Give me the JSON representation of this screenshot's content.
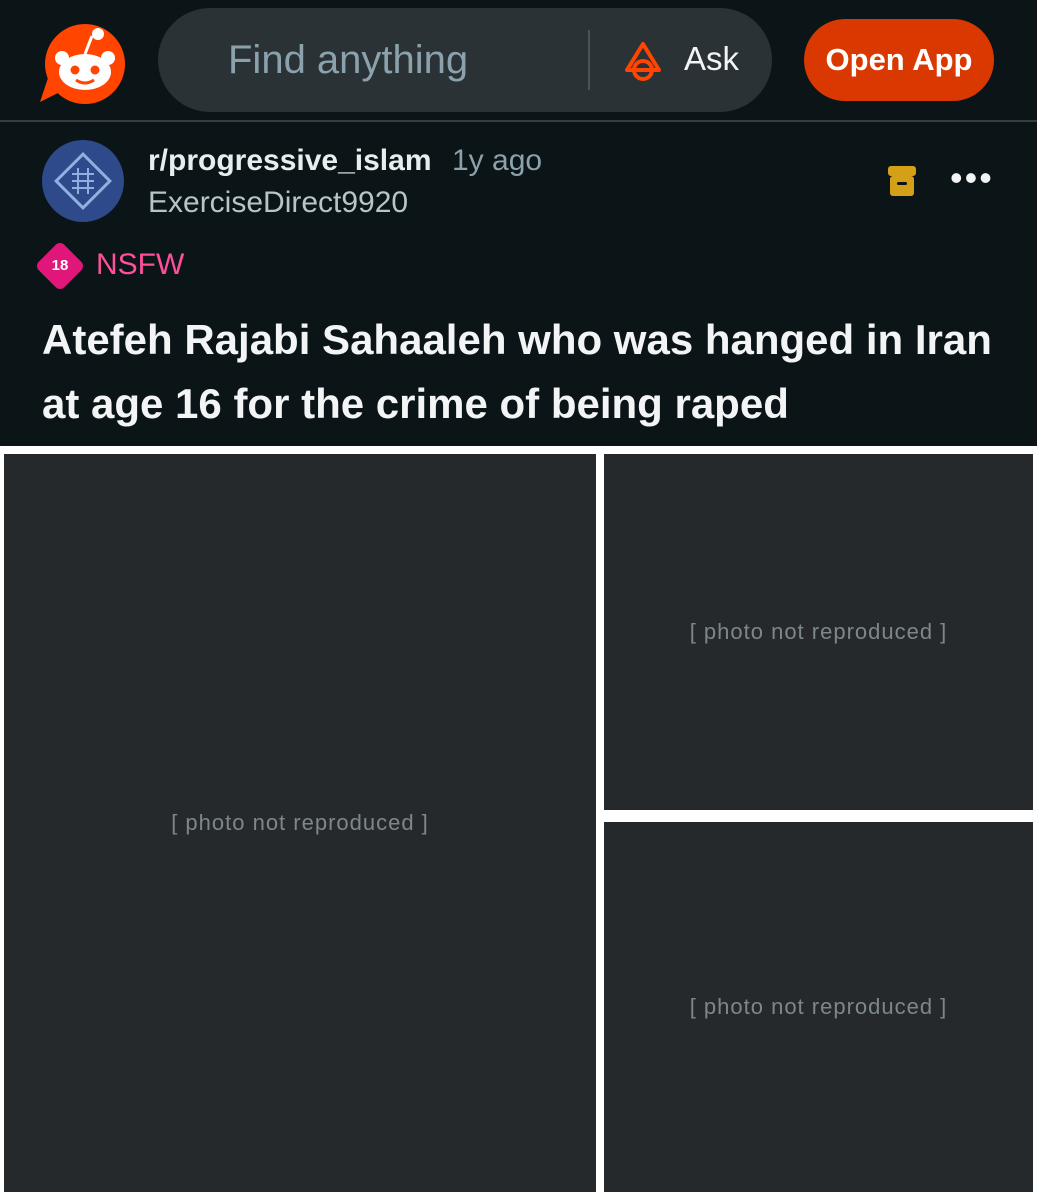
{
  "header": {
    "search_placeholder": "Find anything",
    "ask_label": "Ask",
    "open_app_label": "Open App"
  },
  "post": {
    "subreddit": "r/progressive_islam",
    "time": "1y ago",
    "author": "ExerciseDirect9920",
    "nsfw_age": "18",
    "nsfw_label": "NSFW",
    "title": "Atefeh Rajabi Sahaaleh who was hanged in Iran at age 16 for the crime of being raped"
  },
  "colors": {
    "background": "#0b1416",
    "brand": "#ff4500",
    "open_app": "#d93900",
    "nsfw": "#e0167b",
    "archive": "#d4a017"
  },
  "icons": [
    "reddit-logo-icon",
    "ask-icon",
    "archive-icon",
    "more-icon"
  ]
}
